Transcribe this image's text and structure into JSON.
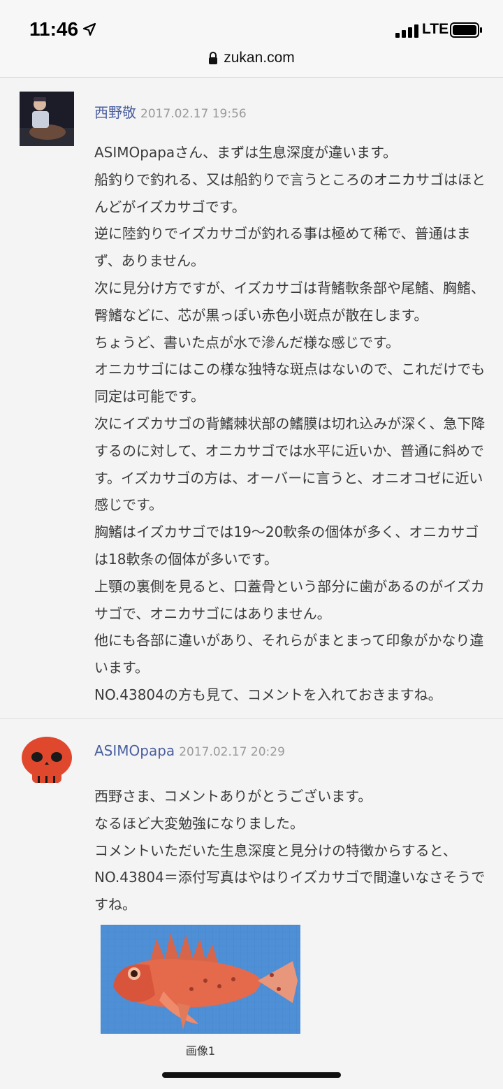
{
  "status_bar": {
    "time": "11:46",
    "network": "LTE",
    "location_icon": "location-arrow-icon",
    "signal_icon": "signal-bars-icon",
    "battery_icon": "battery-icon"
  },
  "browser": {
    "url": "zukan.com",
    "lock_icon": "lock-icon"
  },
  "comments": [
    {
      "author": "西野敬",
      "date": "2017.02.17 19:56",
      "body": "ASIMOpapaさん、まずは生息深度が違います。\n船釣りで釣れる、又は船釣りで言うところのオニカサゴはほとんどがイズカサゴです。\n逆に陸釣りでイズカサゴが釣れる事は極めて稀で、普通はまず、ありません。\n次に見分け方ですが、イズカサゴは背鰭軟条部や尾鰭、胸鰭、臀鰭などに、芯が黒っぽい赤色小斑点が散在します。\nちょうど、書いた点が水で滲んだ様な感じです。\nオニカサゴにはこの様な独特な斑点はないので、これだけでも同定は可能です。\n次にイズカサゴの背鰭棘状部の鰭膜は切れ込みが深く、急下降するのに対して、オニカサゴでは水平に近いか、普通に斜めです。イズカサゴの方は、オーバーに言うと、オニオコゼに近い感じです。\n胸鰭はイズカサゴでは19～20軟条の個体が多く、オニカサゴは18軟条の個体が多いです。\n上顎の裏側を見ると、口蓋骨という部分に歯があるのがイズカサゴで、オニカサゴにはありません。\n他にも各部に違いがあり、それらがまとまって印象がかなり違います。\nNO.43804の方も見て、コメントを入れておきますね。"
    },
    {
      "author": "ASIMOpapa",
      "date": "2017.02.17 20:29",
      "body": "西野さま、コメントありがとうございます。\nなるほど大変勉強になりました。\nコメントいただいた生息深度と見分けの特徴からすると、NO.43804＝添付写真はやはりイズカサゴで間違いなさそうですね。",
      "attachment_caption": "画像1"
    }
  ],
  "colors": {
    "author_link": "#4a5fa0",
    "date_gray": "#9a9a9a",
    "avatar_skull_red": "#e0482e",
    "photo_background_blue": "#4f8fd6"
  }
}
